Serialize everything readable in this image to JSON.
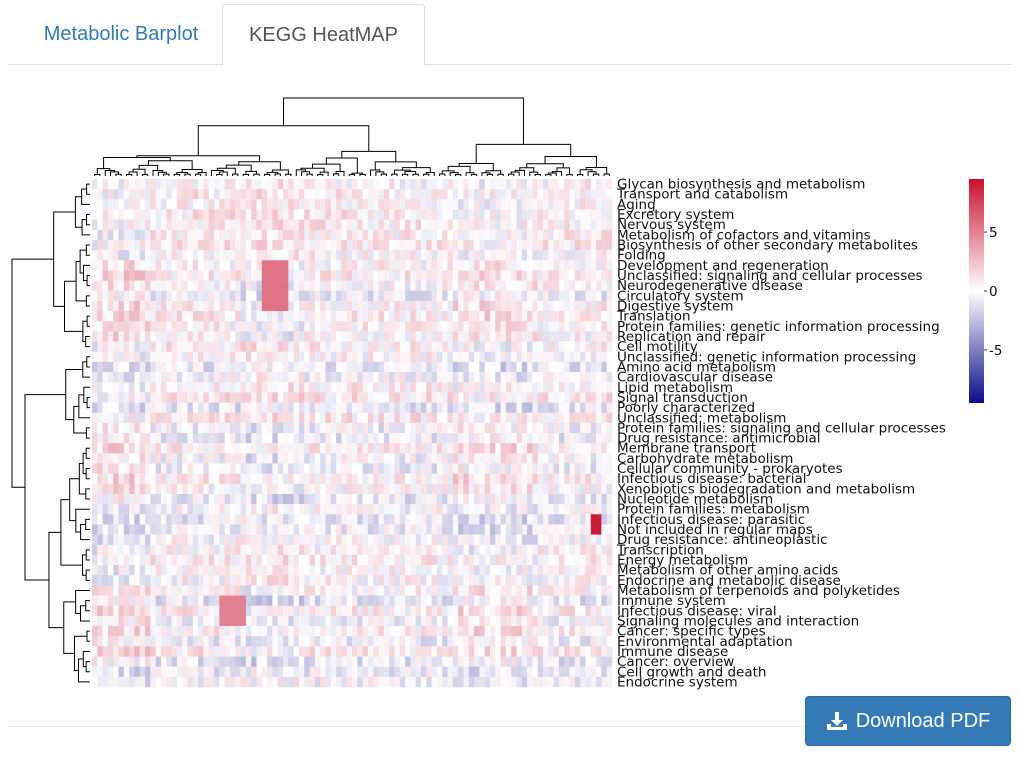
{
  "tabs": [
    {
      "label": "Metabolic Barplot",
      "active": false
    },
    {
      "label": "KEGG HeatMAP",
      "active": true
    }
  ],
  "download_button": {
    "label": "Download PDF",
    "icon": "download-icon"
  },
  "colors": {
    "tab_link": "#337ab7",
    "button_bg": "#337ab7",
    "scale_high": "#c8102e",
    "scale_mid": "#ffffff",
    "scale_low": "#0b0b8a"
  },
  "chart_data": {
    "type": "heatmap",
    "clustered": true,
    "n_columns": 98,
    "rows": [
      "Glycan biosynthesis and metabolism",
      "Transport and catabolism",
      "Aging",
      "Excretory system",
      "Nervous system",
      "Metabolism of cofactors and vitamins",
      "Biosynthesis of other secondary metabolites",
      "Folding",
      "Development and regeneration",
      "Unclassified: signaling and cellular processes",
      "Neurodegenerative disease",
      "Circulatory system",
      "Digestive system",
      "Translation",
      "Protein families: genetic information processing",
      "Replication and repair",
      "Cell motility",
      "Unclassified: genetic information processing",
      "Amino acid metabolism",
      "Cardiovascular disease",
      "Lipid metabolism",
      "Signal transduction",
      "Poorly characterized",
      "Unclassified: metabolism",
      "Protein families: signaling and cellular processes",
      "Drug resistance: antimicrobial",
      "Membrane transport",
      "Carbohydrate metabolism",
      "Cellular community - prokaryotes",
      "Infectious disease: bacterial",
      "Xenobiotics biodegradation and metabolism",
      "Nucleotide metabolism",
      "Protein families: metabolism",
      "Infectious disease: parasitic",
      "Not included in regular maps",
      "Drug resistance: antineoplastic",
      "Transcription",
      "Energy metabolism",
      "Metabolism of other amino acids",
      "Endocrine and metabolic disease",
      "Metabolism of terpenoids and polyketides",
      "Immune system",
      "Infectious disease: viral",
      "Signaling molecules and interaction",
      "Cancer: specific types",
      "Environmental adaptation",
      "Immune disease",
      "Cancer: overview",
      "Cell growth and death",
      "Endocrine system"
    ],
    "legend": {
      "ticks": [
        5,
        0,
        -5
      ],
      "range": [
        -9.5,
        9.5
      ]
    }
  }
}
